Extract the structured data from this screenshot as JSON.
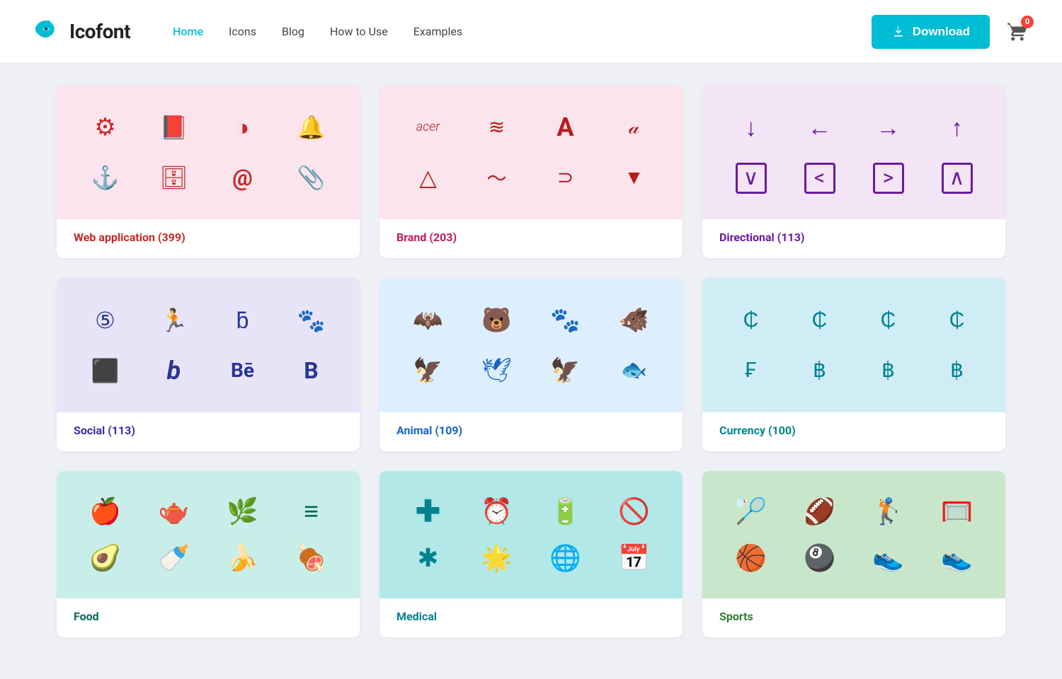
{
  "header": {
    "logo_text": "Icofont",
    "nav_items": [
      {
        "label": "Home",
        "active": true
      },
      {
        "label": "Icons",
        "active": false
      },
      {
        "label": "Blog",
        "active": false
      },
      {
        "label": "How to Use",
        "active": false
      },
      {
        "label": "Examples",
        "active": false
      }
    ],
    "download_label": "Download",
    "cart_count": "0"
  },
  "cards": [
    {
      "id": "web-app",
      "title": "Web application (399)",
      "title_color": "#c62828",
      "bg": "bg-pink",
      "icons": [
        "⚙",
        "📓",
        "◑",
        "🔔",
        "⚓",
        "📦",
        "@",
        "📎"
      ],
      "icon_color": "#c62828"
    },
    {
      "id": "brand",
      "title": "Brand (203)",
      "title_color": "#c2185b",
      "bg": "bg-light-pink",
      "icons": [
        "Acer",
        "≋≋",
        "A",
        "〜",
        "△",
        "〜",
        "〜",
        "▼"
      ],
      "icon_color": "#b71c1c"
    },
    {
      "id": "directional",
      "title": "Directional (113)",
      "title_color": "#6a1b9a",
      "bg": "bg-lavender",
      "icons": [
        "↓",
        "←",
        "→",
        "↑",
        "⌄",
        "⟨",
        "⟩",
        "⌃"
      ],
      "icon_color": "#6a1b9a"
    },
    {
      "id": "social",
      "title": "Social (113)",
      "title_color": "#4527a0",
      "bg": "bg-lilac",
      "icons": [
        "⑤",
        "🏃",
        "♭",
        "🐾",
        "⬛",
        "b",
        "Bē",
        "B"
      ],
      "icon_color": "#283593"
    },
    {
      "id": "animal",
      "title": "Animal (109)",
      "title_color": "#1565c0",
      "bg": "bg-light-blue",
      "icons": [
        "🦇",
        "🐻",
        "👣",
        "🐗",
        "🦅",
        "🕊",
        "🦅",
        "〜"
      ],
      "icon_color": "#1565c0"
    },
    {
      "id": "currency",
      "title": "Currency (100)",
      "title_color": "#00838f",
      "bg": "bg-teal-light",
      "icons": [
        "₵",
        "₵",
        "₵",
        "₵",
        "₣",
        "฿",
        "฿",
        "฿"
      ],
      "icon_color": "#00838f"
    },
    {
      "id": "food",
      "title": "Food",
      "title_color": "#00695c",
      "bg": "bg-mint",
      "icons": [
        "🍎",
        "☕",
        "🌿",
        "〜",
        "🥑",
        "🍼",
        "🍌",
        "🍖"
      ],
      "icon_color": "#00695c"
    },
    {
      "id": "medical",
      "title": "Medical",
      "title_color": "#00838f",
      "bg": "bg-teal-light",
      "icons": [
        "✚",
        "⏰",
        "🔋",
        "🚫",
        "✱",
        "🌟",
        "🌐",
        "📅"
      ],
      "icon_color": "#00838f"
    },
    {
      "id": "sports",
      "title": "Sports",
      "title_color": "#2e7d32",
      "bg": "bg-mint",
      "icons": [
        "🏸",
        "🏈",
        "🏌",
        "🏀",
        "🏀",
        "⑧",
        "👟",
        "👟"
      ],
      "icon_color": "#2e7d32"
    }
  ]
}
